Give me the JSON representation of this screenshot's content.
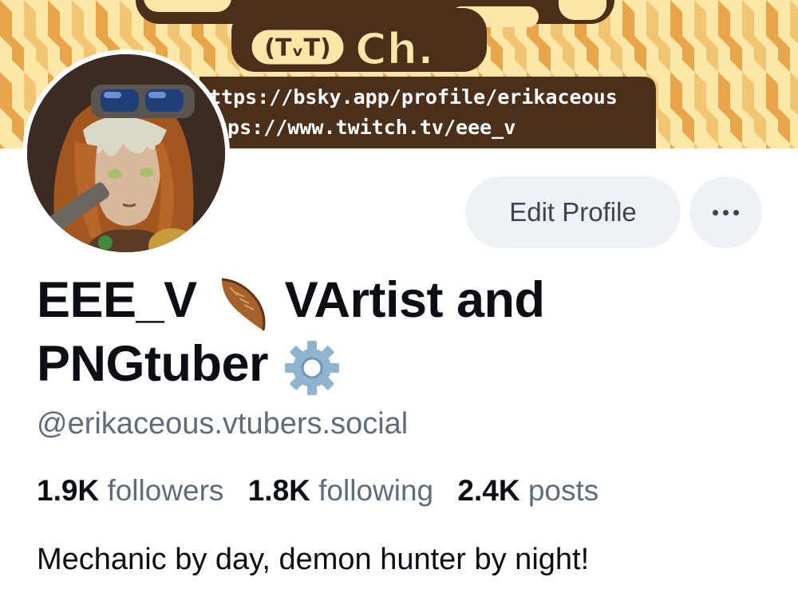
{
  "banner": {
    "emoticon": "(TᵥT)",
    "channel_suffix": "Ch.",
    "link_bluesky": "ttps://bsky.app/profile/erikaceous",
    "link_twitch": "tps://www.twitch.tv/eee_v",
    "colors": {
      "stripe_light": "#fbe7a8",
      "stripe_dark": "#e9a54a",
      "plate": "#4a2f1a"
    }
  },
  "profile": {
    "avatar": "avatar-illustration",
    "name_part1": "EEE_V",
    "name_emoji1": "feather-icon",
    "name_part2": "VArtist and",
    "name_part3": "PNGtuber",
    "name_emoji2": "gear-icon",
    "handle": "@erikaceous.vtubers.social",
    "bio": "Mechanic by day, demon hunter by night!"
  },
  "actions": {
    "edit_label": "Edit Profile",
    "more_icon": "ellipsis-icon"
  },
  "stats": {
    "followers_count": "1.9K",
    "followers_label": "followers",
    "following_count": "1.8K",
    "following_label": "following",
    "posts_count": "2.4K",
    "posts_label": "posts"
  }
}
